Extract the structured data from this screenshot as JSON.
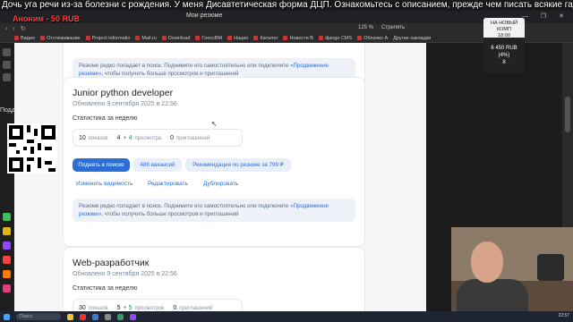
{
  "overlay": {
    "banner": "Дочь уга речи из-за болезни с рождения. У меня Дисавтетическая форма ДЦП. Ознакомьтесь с описанием, прежде чем писать всякие гадости.",
    "donation": "Аноним - 50 RUB",
    "qr_label": "Подд"
  },
  "browser": {
    "tab_title": "Мои резюме",
    "zoom": "125 %",
    "reader": "Стрелять",
    "window_controls": "— ❐ ✕",
    "bookmarks": [
      "Видео",
      "Отслеживание",
      "Project informatio",
      "Mail.ru",
      "Download",
      "ГлоссBM",
      "Нацио",
      "Каталог",
      "Новости В",
      "django CMS",
      "Облачко А",
      "Другие закладки"
    ]
  },
  "wallet": {
    "title": "НА НОВЫЙ КОМП",
    "time": "18:00",
    "amount": "6 450 RUB",
    "percent": "(4%)",
    "extra": "8"
  },
  "resumes": {
    "card1": {
      "notice_a": "Резюме редко попадает в поиск. Поднимите его самостоятельно или подключите ",
      "notice_link": "«Продвижение резюме»",
      "notice_b": ", чтобы получить больше просмотров и приглашений"
    },
    "card2": {
      "title": "Junior python developer",
      "updated": "Обновлено 9 сентября 2025 в 22:56",
      "stats_heading": "Статистика за неделю",
      "shows_num": "10",
      "shows_label": "показов",
      "views_num": "4",
      "views_delta": "+ 4",
      "views_label": "просмотра",
      "invites_num": "0",
      "invites_label": "приглашений",
      "btn_raise": "Поднять в поиске",
      "btn_vacancies": "486 вакансий",
      "btn_recommend": "Рекомендация по резюме за 799 ₽",
      "link_visibility": "Изменить видимость",
      "link_edit": "Редактировать",
      "link_duplicate": "Дублировать",
      "notice_a": "Резюме редко попадает в поиск. Поднимите его самостоятельно или подключите ",
      "notice_link": "«Продвижение резюме»",
      "notice_b": ", чтобы получить больше просмотров и приглашений"
    },
    "card3": {
      "title": "Web-разработчик",
      "updated": "Обновлено 9 сентября 2025 в 22:56",
      "stats_heading": "Статистика за неделю",
      "shows_num": "30",
      "shows_label": "показов",
      "views_num": "5",
      "views_delta": "+ 5",
      "views_label": "просмотров",
      "invites_num": "0",
      "invites_label": "приглашений"
    }
  },
  "taskbar": {
    "search": "Поиск",
    "clock": "22:57"
  }
}
